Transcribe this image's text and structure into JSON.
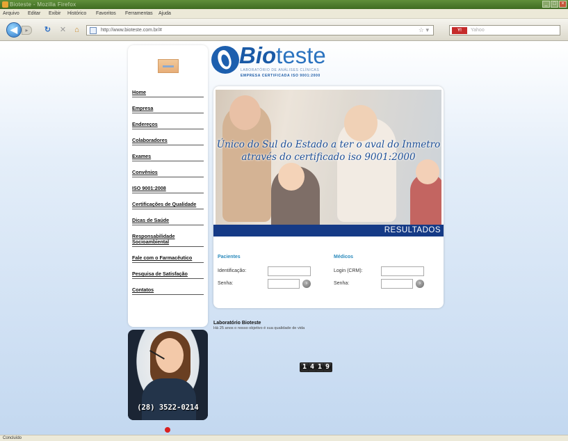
{
  "window": {
    "title": "Bioteste - Mozilla Firefox"
  },
  "menubar": {
    "items": [
      "Arquivo",
      "Editar",
      "Exibir",
      "Histórico",
      "Favoritos",
      "Ferramentas",
      "Ajuda"
    ]
  },
  "toolbar": {
    "url": "http://www.bioteste.com.br/#",
    "search_placeholder": "Yahoo",
    "search_engine": "Y!"
  },
  "brand": {
    "name_bold": "Bio",
    "name_light": "teste",
    "tagline_1": "LABORATÓRIO DE ANÁLISES CLÍNICAS",
    "tagline_2": "EMPRESA CERTIFICADA ISO 9001:2000"
  },
  "sidebar": {
    "items": [
      {
        "label": "Home"
      },
      {
        "label": "Empresa"
      },
      {
        "label": "Endereços"
      },
      {
        "label": "Colaboradores"
      },
      {
        "label": "Exames"
      },
      {
        "label": "Convênios"
      },
      {
        "label": "ISO 9001:2008"
      },
      {
        "label": "Certificações de Qualidade"
      },
      {
        "label": "Dicas de Saúde"
      },
      {
        "label": "Responsabilidade Socioambiental"
      },
      {
        "label": "Fale com o Farmacêutico"
      },
      {
        "label": "Pesquisa de Satisfação"
      },
      {
        "label": "Contatos"
      }
    ],
    "phone": "(28) 3522-0214"
  },
  "hero": {
    "slogan": "Único do Sul do Estado a ter o aval do Inmetro através do certificado iso 9001:2000"
  },
  "results": {
    "title": "RESULTADOS",
    "patients": {
      "heading": "Pacientes",
      "id_label": "Identificação:",
      "id_value": "",
      "password_label": "Senha:",
      "password_value": ""
    },
    "doctors": {
      "heading": "Médicos",
      "login_label": "Login (CRM):",
      "login_value": "",
      "password_label": "Senha:",
      "password_value": ""
    }
  },
  "lab": {
    "title": "Laboratório Bioteste",
    "subtitle": "Há 25 anos o nosso objetivo é sua qualidade de vida"
  },
  "visit_counter": "1419",
  "status_bar": "Concluído"
}
